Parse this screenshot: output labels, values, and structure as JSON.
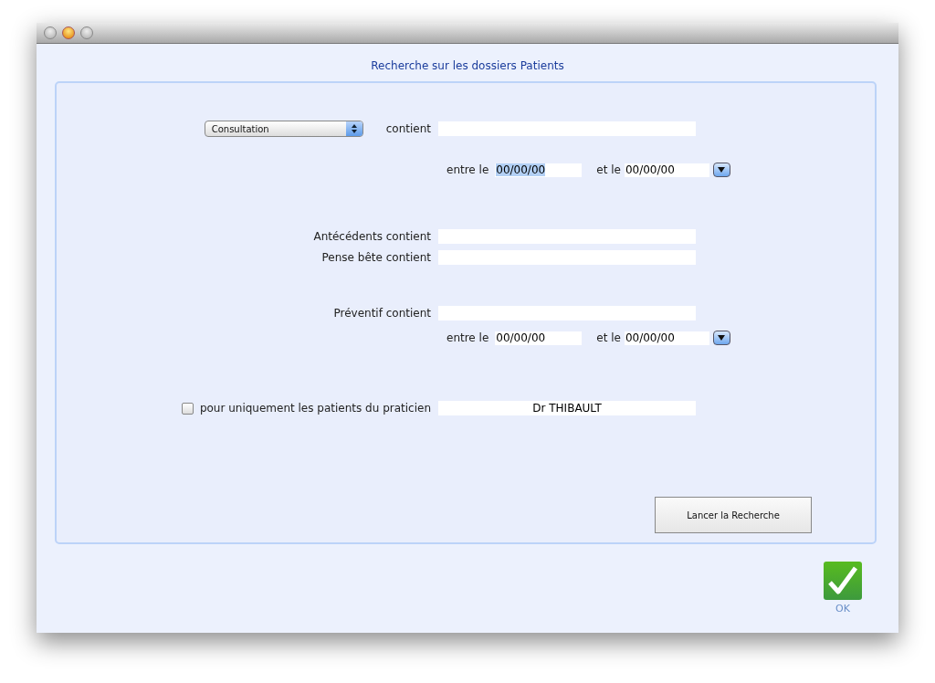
{
  "window": {
    "title": "Recherche sur les dossiers Patients"
  },
  "consultation": {
    "dropdown": "Consultation",
    "label": "contient",
    "dates": [
      {
        "label": "entre le",
        "value": "00/00/00",
        "highlighted": true
      },
      {
        "label": "et le",
        "value": "00/00/00",
        "highlighted": false
      }
    ]
  },
  "text_criteria": [
    {
      "label": "Antécédents contient"
    },
    {
      "label": "Pense bête contient"
    }
  ],
  "preventif": {
    "label": "Préventif contient",
    "dates": [
      {
        "label": "entre le",
        "value": "00/00/00",
        "highlighted": false
      },
      {
        "label": "et le",
        "value": "00/00/00",
        "highlighted": false
      }
    ]
  },
  "practitioner_filter": {
    "label": "pour uniquement les patients du praticien",
    "checked": false,
    "value": "Dr THIBAULT"
  },
  "search_button": "Lancer la Recherche",
  "ok_button": "OK"
}
